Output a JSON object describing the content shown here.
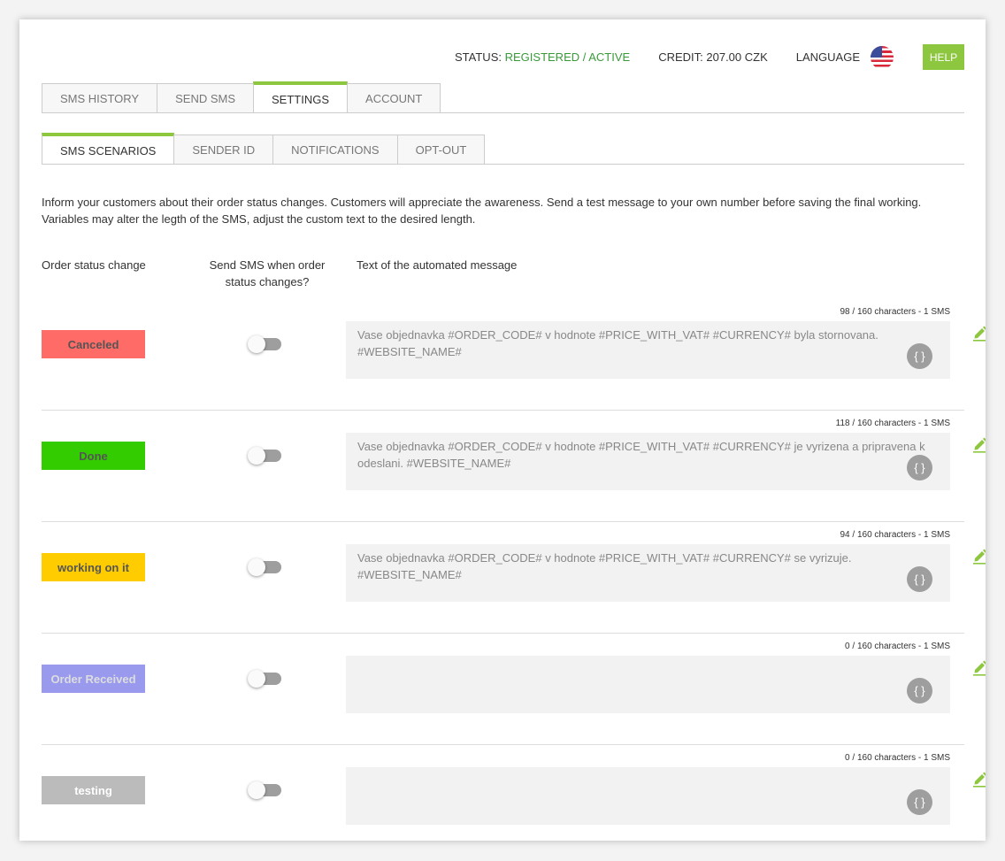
{
  "topbar": {
    "status_label": "STATUS:",
    "status_value": "REGISTERED / ACTIVE",
    "credit": "CREDIT: 207.00 CZK",
    "language_label": "LANGUAGE",
    "help": "HELP",
    "status_color": "#3a9a3a",
    "accent": "#8dc63f"
  },
  "tabs": [
    {
      "label": "SMS HISTORY"
    },
    {
      "label": "SEND SMS"
    },
    {
      "label": "SETTINGS"
    },
    {
      "label": "ACCOUNT"
    }
  ],
  "subtabs": [
    {
      "label": "SMS SCENARIOS"
    },
    {
      "label": "SENDER ID"
    },
    {
      "label": "NOTIFICATIONS"
    },
    {
      "label": "OPT-OUT"
    }
  ],
  "intro": "Inform your customers about their order status changes. Customers will appreciate the awareness. Send a test message to your own number before saving the final working. Variables may alter the legth of the SMS, adjust the custom text to the desired length.",
  "columns": {
    "status": "Order status change",
    "send": "Send SMS when order status changes?",
    "text": "Text of the automated message"
  },
  "rows": [
    {
      "status": "Canceled",
      "bg": "#ff6b66",
      "fg": "#555555",
      "counter": "98 / 160 characters - 1 SMS",
      "message": "Vase objednavka #ORDER_CODE# v hodnote #PRICE_WITH_VAT# #CURRENCY# byla stornovana. #WEBSITE_NAME#",
      "enabled": false
    },
    {
      "status": "Done",
      "bg": "#33cc00",
      "fg": "#555555",
      "counter": "118 / 160 characters - 1 SMS",
      "message": "Vase objednavka #ORDER_CODE# v hodnote #PRICE_WITH_VAT# #CURRENCY# je vyrizena a pripravena k odeslani. #WEBSITE_NAME#",
      "enabled": false
    },
    {
      "status": "working on it",
      "bg": "#ffcc00",
      "fg": "#555555",
      "counter": "94 / 160 characters - 1 SMS",
      "message": "Vase objednavka #ORDER_CODE# v hodnote #PRICE_WITH_VAT# #CURRENCY# se vyrizuje. #WEBSITE_NAME#",
      "enabled": false
    },
    {
      "status": "Order Received",
      "bg": "#9999ee",
      "fg": "#dddddd",
      "counter": "0 / 160 characters - 1 SMS",
      "message": "",
      "enabled": false
    },
    {
      "status": "testing",
      "bg": "#bbbbbb",
      "fg": "#ffffff",
      "counter": "0 / 160 characters - 1 SMS",
      "message": "",
      "enabled": false
    }
  ],
  "variable_button": "{ }",
  "icons": {
    "flag": "us-flag-icon",
    "edit": "pencil-icon"
  }
}
